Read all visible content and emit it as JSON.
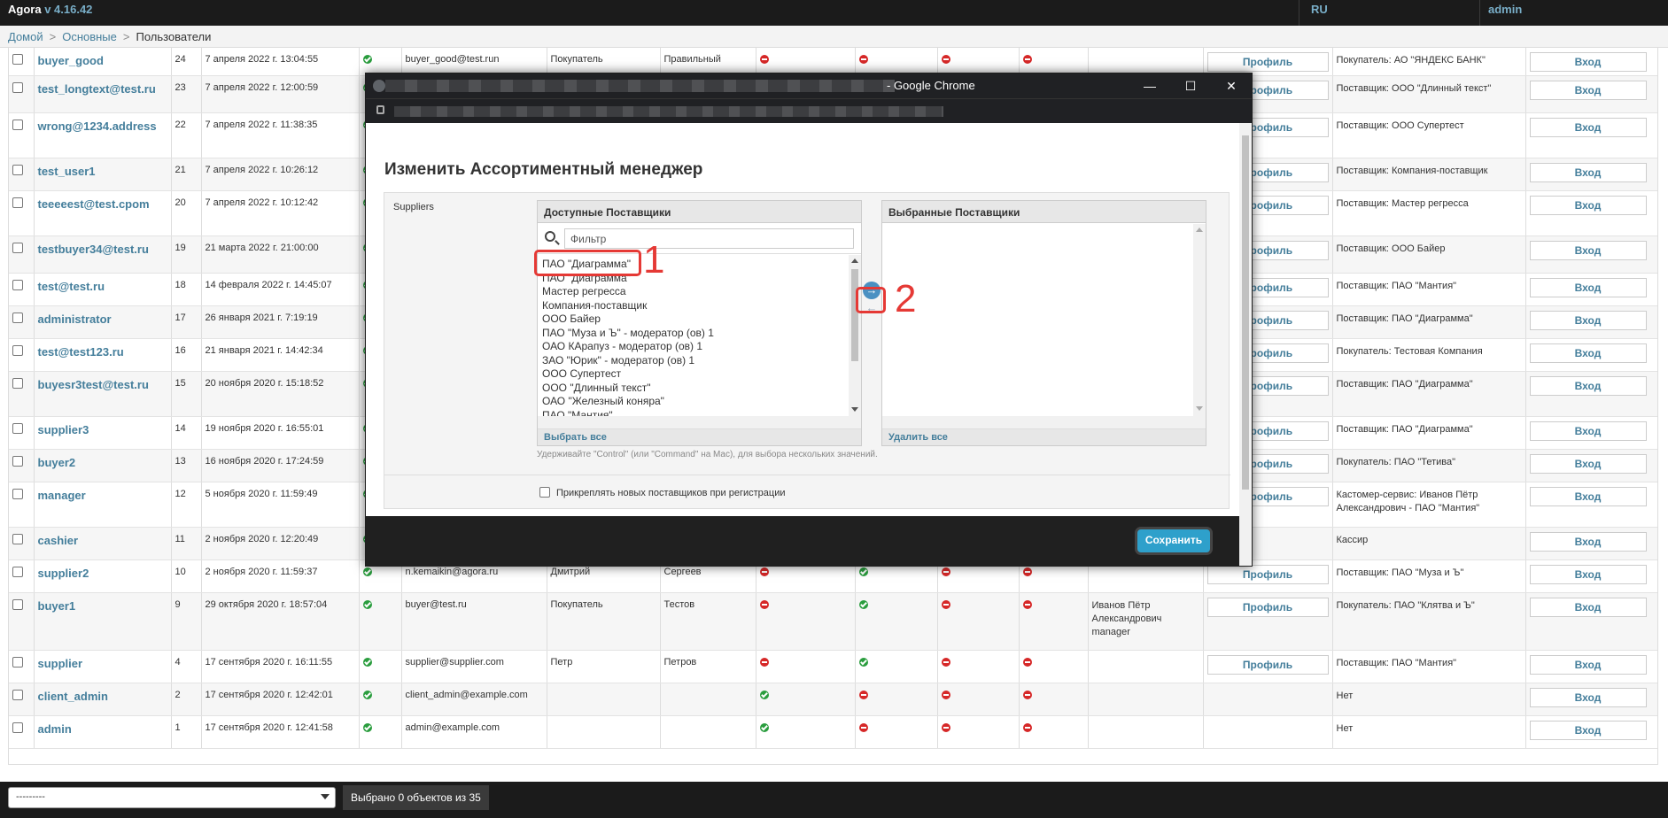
{
  "topbar": {
    "brand": "Agora",
    "version": "v 4.16.42",
    "lang": "RU",
    "user": "admin"
  },
  "breadcrumbs": {
    "home": "Домой",
    "section": "Основные",
    "current": "Пользователи"
  },
  "table": {
    "profile_label": "Профиль",
    "login_label": "Вход",
    "rows": [
      {
        "login": "buyer_good",
        "id": "24",
        "date": "7 апреля 2022 г. 13:04:55",
        "email": "buyer_good@test.run",
        "first": "Покупатель",
        "last": "Правильный",
        "f1": "no",
        "f2": "no",
        "f3": "no",
        "f4": "no",
        "manager": "",
        "profile": true,
        "role": "Покупатель: АО \"ЯНДЕКС БАНК\""
      },
      {
        "login": "test_longtext@test.ru",
        "id": "23",
        "date": "7 апреля 2022 г. 12:00:59",
        "email": "",
        "first": "",
        "last": "",
        "f1": "",
        "f2": "",
        "f3": "",
        "f4": "",
        "manager": "",
        "profile": true,
        "role": "Поставщик: ООО \"Длинный текст\""
      },
      {
        "login": "wrong@1234.address",
        "id": "22",
        "date": "7 апреля 2022 г. 11:38:35",
        "email": "",
        "first": "",
        "last": "",
        "f1": "",
        "f2": "",
        "f3": "",
        "f4": "",
        "manager": "",
        "profile": true,
        "role": "Поставщик: ООО Супертест"
      },
      {
        "login": "test_user1",
        "id": "21",
        "date": "7 апреля 2022 г. 10:26:12",
        "email": "",
        "first": "",
        "last": "",
        "f1": "",
        "f2": "",
        "f3": "",
        "f4": "",
        "manager": "",
        "profile": true,
        "role": "Поставщик: Компания-поставщик"
      },
      {
        "login": "teeeeest@test.cpom",
        "id": "20",
        "date": "7 апреля 2022 г. 10:12:42",
        "email": "",
        "first": "",
        "last": "",
        "f1": "",
        "f2": "",
        "f3": "",
        "f4": "",
        "manager": "",
        "profile": true,
        "role": "Поставщик: Мастер регресса"
      },
      {
        "login": "testbuyer34@test.ru",
        "id": "19",
        "date": "21 марта 2022 г. 21:00:00",
        "email": "",
        "first": "",
        "last": "",
        "f1": "",
        "f2": "",
        "f3": "",
        "f4": "",
        "manager": "",
        "profile": true,
        "role": "Поставщик: ООО Байер"
      },
      {
        "login": "test@test.ru",
        "id": "18",
        "date": "14 февраля 2022 г. 14:45:07",
        "email": "",
        "first": "",
        "last": "",
        "f1": "",
        "f2": "",
        "f3": "",
        "f4": "",
        "manager": "",
        "profile": true,
        "role": "Поставщик: ПАО \"Мантия\""
      },
      {
        "login": "administrator",
        "id": "17",
        "date": "26 января 2021 г. 7:19:19",
        "email": "",
        "first": "",
        "last": "",
        "f1": "",
        "f2": "",
        "f3": "",
        "f4": "",
        "manager": "",
        "profile": true,
        "role": "Поставщик: ПАО \"Диаграмма\""
      },
      {
        "login": "test@test123.ru",
        "id": "16",
        "date": "21 января 2021 г. 14:42:34",
        "email": "",
        "first": "",
        "last": "",
        "f1": "",
        "f2": "",
        "f3": "",
        "f4": "",
        "manager": "",
        "profile": true,
        "role": "Покупатель: Тестовая Компания"
      },
      {
        "login": "buyesr3test@test.ru",
        "id": "15",
        "date": "20 ноября 2020 г. 15:18:52",
        "email": "",
        "first": "",
        "last": "",
        "f1": "",
        "f2": "",
        "f3": "",
        "f4": "",
        "manager": "",
        "profile": true,
        "role": "Поставщик: ПАО \"Диаграмма\""
      },
      {
        "login": "supplier3",
        "id": "14",
        "date": "19 ноября 2020 г. 16:55:01",
        "email": "",
        "first": "",
        "last": "",
        "f1": "",
        "f2": "",
        "f3": "",
        "f4": "",
        "manager": "",
        "profile": true,
        "role": "Поставщик: ПАО \"Диаграмма\""
      },
      {
        "login": "buyer2",
        "id": "13",
        "date": "16 ноября 2020 г. 17:24:59",
        "email": "",
        "first": "",
        "last": "",
        "f1": "",
        "f2": "",
        "f3": "",
        "f4": "",
        "manager": "",
        "profile": true,
        "role": "Покупатель: ПАО \"Тетива\""
      },
      {
        "login": "manager",
        "id": "12",
        "date": "5 ноября 2020 г. 11:59:49",
        "email": "",
        "first": "",
        "last": "",
        "f1": "",
        "f2": "",
        "f3": "",
        "f4": "",
        "manager": "",
        "profile": true,
        "role": "Кастомер-сервис: Иванов Пётр Александрович - ПАО \"Мантия\""
      },
      {
        "login": "cashier",
        "id": "11",
        "date": "2 ноября 2020 г. 12:20:49",
        "email": "",
        "first": "",
        "last": "",
        "f1": "",
        "f2": "",
        "f3": "",
        "f4": "",
        "manager": "",
        "profile": false,
        "role": "Кассир"
      },
      {
        "login": "supplier2",
        "id": "10",
        "date": "2 ноября 2020 г. 11:59:37",
        "email": "n.kemaikin@agora.ru",
        "first": "Дмитрий",
        "last": "Сергеев",
        "f1": "no",
        "f2": "ok",
        "f3": "no",
        "f4": "no",
        "manager": "",
        "profile": true,
        "role": "Поставщик: ПАО \"Муза и Ъ\""
      },
      {
        "login": "buyer1",
        "id": "9",
        "date": "29 октября 2020 г. 18:57:04",
        "email": "buyer@test.ru",
        "first": "Покупатель",
        "last": "Тестов",
        "f1": "no",
        "f2": "ok",
        "f3": "no",
        "f4": "no",
        "manager": "Иванов Пётр Александрович manager",
        "profile": true,
        "role": "Покупатель: ПАО \"Клятва и Ъ\""
      },
      {
        "login": "supplier",
        "id": "4",
        "date": "17 сентября 2020 г. 16:11:55",
        "email": "supplier@supplier.com",
        "first": "Петр",
        "last": "Петров",
        "f1": "no",
        "f2": "ok",
        "f3": "no",
        "f4": "no",
        "manager": "",
        "profile": true,
        "role": "Поставщик: ПАО \"Мантия\""
      },
      {
        "login": "client_admin",
        "id": "2",
        "date": "17 сентября 2020 г. 12:42:01",
        "email": "client_admin@example.com",
        "first": "",
        "last": "",
        "f1": "ok",
        "f2": "no",
        "f3": "no",
        "f4": "no",
        "manager": "",
        "profile": false,
        "role": "Нет"
      },
      {
        "login": "admin",
        "id": "1",
        "date": "17 сентября 2020 г. 12:41:58",
        "email": "admin@example.com",
        "first": "",
        "last": "",
        "f1": "ok",
        "f2": "no",
        "f3": "no",
        "f4": "no",
        "manager": "",
        "profile": false,
        "role": "Нет"
      }
    ]
  },
  "bottom": {
    "action_value": "---------",
    "selected_count": "Выбрано 0 объектов из 35"
  },
  "chrome": {
    "title_suffix": "- Google Chrome",
    "minimize": "—",
    "maximize": "☐",
    "close": "✕"
  },
  "modal": {
    "title": "Изменить Ассортиментный менеджер",
    "field_label": "Suppliers",
    "available_header": "Доступные Поставщики",
    "filter_placeholder": "Фильтр",
    "available_items": [
      "ПАО \"Диаграмма\"",
      "ПАО \"Диаграмма\"",
      "Мастер регресса",
      "Компания-поставщик",
      "ООО Байер",
      "ПАО \"Муза и Ъ\" - модератор (ов) 1",
      "ОАО КАрапуз - модератор (ов) 1",
      "ЗАО \"Юрик\" - модератор (ов) 1",
      "ООО Супертест",
      "ООО \"Длинный текст\"",
      "ОАО \"Железный коняра\"",
      "ПАО \"Мантия\""
    ],
    "select_all": "Выбрать все",
    "chosen_header": "Выбранные Поставщики",
    "remove_all": "Удалить все",
    "help_text": "Удерживайте \"Control\" (или \"Command\" на Mac), для выбора нескольких значений.",
    "attach_label": "Прикреплять новых поставщиков при регистрации",
    "save_label": "Сохранить",
    "move_right": "→",
    "move_left": "←"
  },
  "annotations": {
    "step1": "1",
    "step2": "2"
  },
  "colors": {
    "accent": "#447e9b",
    "annotation": "#e53935",
    "save": "#2ea0cb",
    "ok": "#2a9d3e",
    "no": "#d62828"
  }
}
